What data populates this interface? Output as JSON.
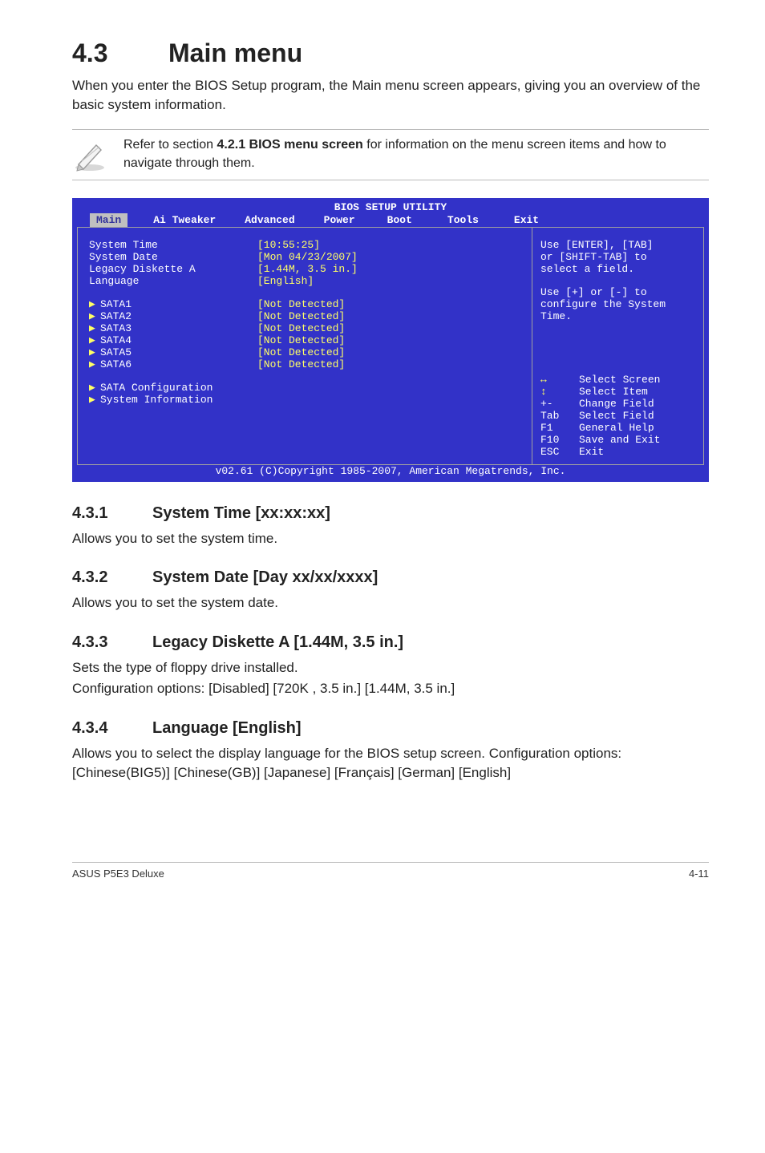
{
  "section": {
    "num": "4.3",
    "title": "Main menu"
  },
  "intro": "When you enter the BIOS Setup program, the Main menu screen appears, giving you an overview of the basic system information.",
  "note": {
    "pre": "Refer to section ",
    "bold": "4.2.1  BIOS menu screen",
    "post": " for information on the menu screen items and how to navigate through them."
  },
  "bios": {
    "title": "BIOS SETUP UTILITY",
    "tabs": [
      "Main",
      "Ai Tweaker",
      "Advanced",
      "Power",
      "Boot",
      "Tools",
      "Exit"
    ],
    "selected_tab": "Main",
    "rows": [
      {
        "key": "System Time",
        "val": "[10:55:25]"
      },
      {
        "key": "System Date",
        "val": "[Mon 04/23/2007]"
      },
      {
        "key": "Legacy Diskette A",
        "val": "[1.44M, 3.5 in.]"
      },
      {
        "key": "Language",
        "val": "[English]"
      }
    ],
    "sata": [
      {
        "key": "SATA1",
        "val": "[Not Detected]"
      },
      {
        "key": "SATA2",
        "val": "[Not Detected]"
      },
      {
        "key": "SATA3",
        "val": "[Not Detected]"
      },
      {
        "key": "SATA4",
        "val": "[Not Detected]"
      },
      {
        "key": "SATA5",
        "val": "[Not Detected]"
      },
      {
        "key": "SATA6",
        "val": "[Not Detected]"
      }
    ],
    "extra": [
      "SATA Configuration",
      "System Information"
    ],
    "help_top": [
      "Use [ENTER], [TAB]",
      "or [SHIFT-TAB] to",
      "select a field."
    ],
    "help_mid": [
      "Use [+] or [-] to",
      "configure the System",
      "Time."
    ],
    "nav": [
      {
        "icon": "↔",
        "key": "",
        "val": "Select Screen"
      },
      {
        "icon": "↕",
        "key": "",
        "val": "Select Item"
      },
      {
        "icon": "",
        "key": "+-",
        "val": "Change Field"
      },
      {
        "icon": "",
        "key": "Tab",
        "val": "Select Field"
      },
      {
        "icon": "",
        "key": "F1",
        "val": "General Help"
      },
      {
        "icon": "",
        "key": "F10",
        "val": "Save and Exit"
      },
      {
        "icon": "",
        "key": "ESC",
        "val": "Exit"
      }
    ],
    "copyright": "v02.61 (C)Copyright 1985-2007, American Megatrends, Inc."
  },
  "subs": [
    {
      "num": "4.3.1",
      "title": "System Time [xx:xx:xx]",
      "body": [
        "Allows you to set the system time."
      ]
    },
    {
      "num": "4.3.2",
      "title": "System Date [Day xx/xx/xxxx]",
      "body": [
        "Allows you to set the system date."
      ]
    },
    {
      "num": "4.3.3",
      "title": "Legacy Diskette A [1.44M, 3.5 in.]",
      "body": [
        "Sets the type of floppy drive installed.",
        "Configuration options: [Disabled] [720K , 3.5 in.] [1.44M, 3.5 in.]"
      ]
    },
    {
      "num": "4.3.4",
      "title": "Language [English]",
      "body": [
        "Allows you to select the display language for the BIOS setup screen. Configuration options: [Chinese(BIG5)] [Chinese(GB)] [Japanese] [Français] [German] [English]"
      ]
    }
  ],
  "footer": {
    "left": "ASUS P5E3 Deluxe",
    "right": "4-11"
  }
}
